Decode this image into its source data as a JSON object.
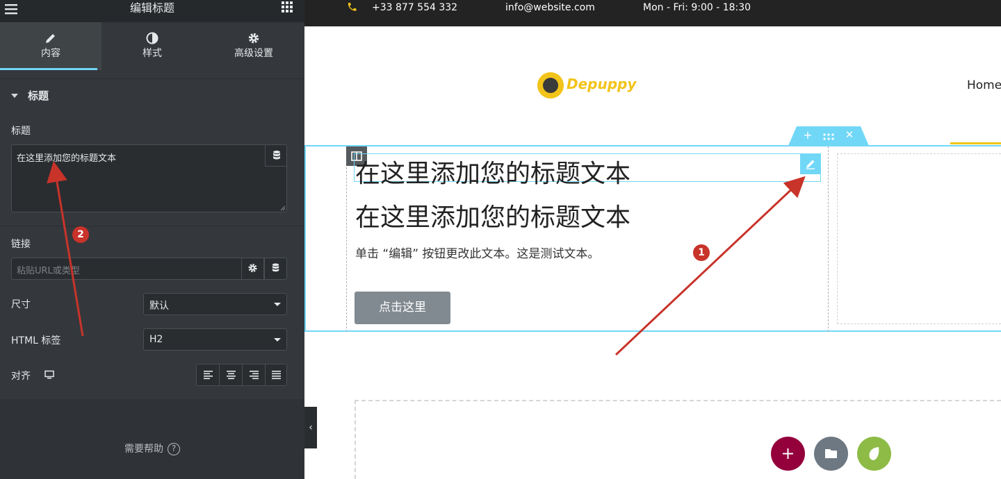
{
  "panel": {
    "header_title": "编辑标题",
    "tabs": [
      {
        "label": "内容",
        "icon": "pencil-icon",
        "active": true
      },
      {
        "label": "样式",
        "icon": "half-circle-icon",
        "active": false
      },
      {
        "label": "高级设置",
        "icon": "gear-icon",
        "active": false
      }
    ],
    "section_title": "标题",
    "heading_label": "标题",
    "heading_value": "在这里添加您的标题文本",
    "link_label": "链接",
    "link_placeholder": "粘贴URL或类型",
    "size_label": "尺寸",
    "size_value": "默认",
    "html_tag_label": "HTML 标签",
    "html_tag_value": "H2",
    "align_label": "对齐",
    "help_label": "需要帮助",
    "accent": "#71d7f7"
  },
  "preview": {
    "topbar": {
      "phone": "+33 877 554 332",
      "email": "info@website.com",
      "hours": "Mon - Fri: 9:00 - 18:30"
    },
    "logo_text": "Depuppy",
    "nav_home": "Home",
    "heading_1": "在这里添加您的标题文本",
    "heading_2": "在这里添加您的标题文本",
    "paragraph": "单击 “编辑” 按钮更改此文本。这是测试文本。",
    "button_label": "点击这里",
    "brand_yellow": "#f2c31a"
  },
  "annotations": {
    "badge_1": "1",
    "badge_2": "2",
    "arrow_color": "#c8332a"
  }
}
